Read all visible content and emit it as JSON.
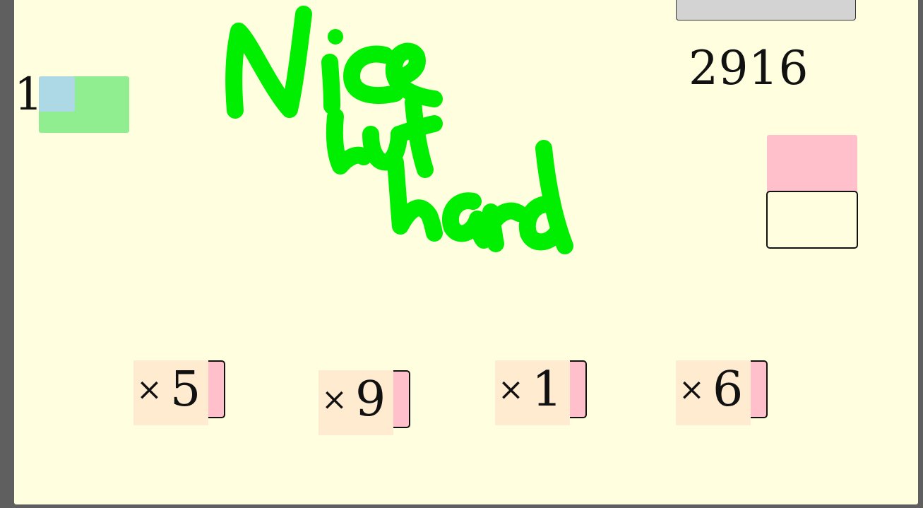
{
  "game": {
    "target": "2916",
    "counter": "1",
    "tiles": [
      {
        "op": "×",
        "value": "5"
      },
      {
        "op": "×",
        "value": "9"
      },
      {
        "op": "×",
        "value": "1"
      },
      {
        "op": "×",
        "value": "6"
      }
    ]
  },
  "colors": {
    "background": "#ffffe0",
    "frame": "#5f5f5f",
    "tile_face": "#ffebd0",
    "tile_tab": "#ffc0cb",
    "slot_green": "#90ee90",
    "slot_blue": "#add8e6",
    "button_gray": "#d3d3d3",
    "ink_green": "#00ee00"
  },
  "icons": {
    "annotation": "handwritten-scribble-nice-but-hard"
  }
}
